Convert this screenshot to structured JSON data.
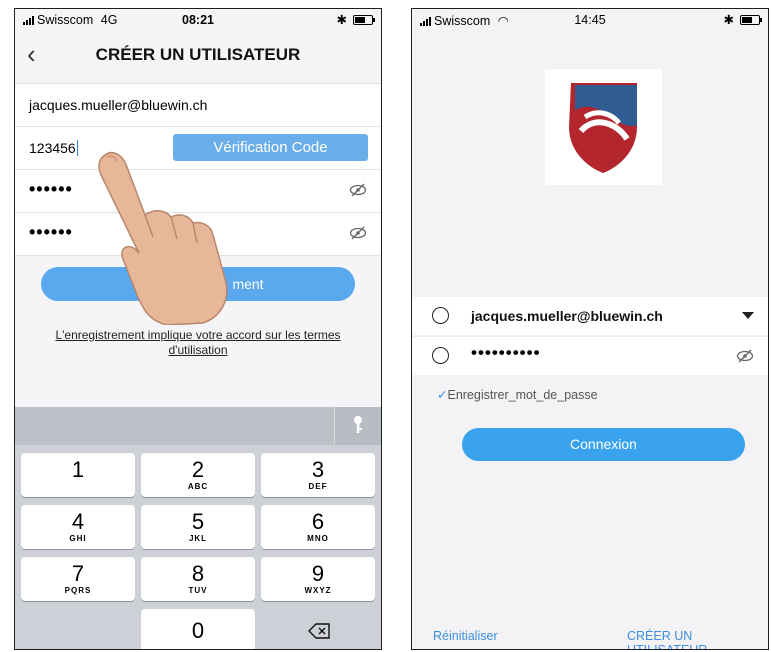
{
  "left_screen": {
    "status": {
      "carrier": "Swisscom",
      "network": "4G",
      "time": "08:21"
    },
    "nav": {
      "back_icon": "chevron-left-icon",
      "title": "CRÉER UN UTILISATEUR"
    },
    "form": {
      "email_value": "jacques.mueller@bluewin.ch",
      "code_value": "123456",
      "verification_button": "Vérification Code",
      "password_value": "••••••",
      "confirm_password_value": "••••••"
    },
    "register_button": "ment",
    "terms_text": "L'enregistrement implique votre accord sur les termes d'utilisation",
    "keyboard": {
      "keys": [
        {
          "number": "1",
          "letters": ""
        },
        {
          "number": "2",
          "letters": "ABC"
        },
        {
          "number": "3",
          "letters": "DEF"
        },
        {
          "number": "4",
          "letters": "GHI"
        },
        {
          "number": "5",
          "letters": "JKL"
        },
        {
          "number": "6",
          "letters": "MNO"
        },
        {
          "number": "7",
          "letters": "PQRS"
        },
        {
          "number": "8",
          "letters": "TUV"
        },
        {
          "number": "9",
          "letters": "WXYZ"
        },
        {
          "number": "0",
          "letters": ""
        }
      ],
      "key_icon": "key-icon",
      "delete_icon": "backspace-icon"
    }
  },
  "right_screen": {
    "status": {
      "carrier": "Swisscom",
      "time": "14:45"
    },
    "login": {
      "email_value": "jacques.mueller@bluewin.ch",
      "password_value": "••••••••••",
      "remember_label": "Enregistrer_mot_de_passe",
      "remember_checked": true
    },
    "connexion_button": "Connexion",
    "reset_link": "Réinitialiser",
    "create_user_link": "CRÉER UN UTILISATEUR"
  },
  "colors": {
    "accent_blue": "#3aa3ee",
    "logo_blue": "#2f5d93",
    "logo_red": "#b3262d"
  }
}
